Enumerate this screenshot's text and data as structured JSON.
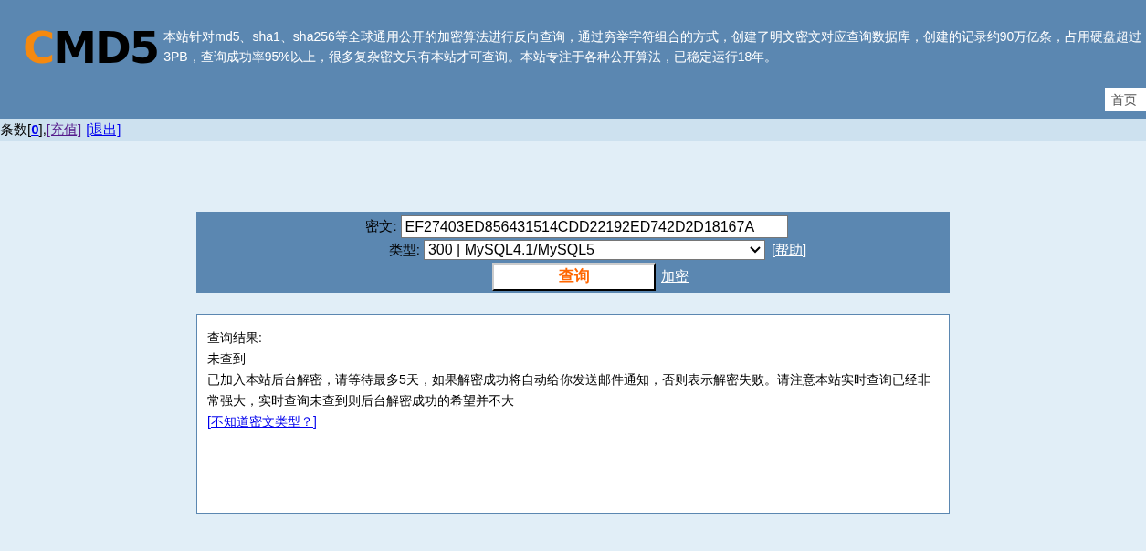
{
  "header": {
    "logo_first": "C",
    "logo_rest": "MD5",
    "intro": "本站针对md5、sha1、sha256等全球通用公开的加密算法进行反向查询，通过穷举字符组合的方式，创建了明文密文对应查询数据库，创建的记录约90万亿条，占用硬盘超过3PB，查询成功率95%以上，很多复杂密文只有本站才可查询。本站专注于各种公开算法，已稳定运行18年。",
    "nav": [
      "首页"
    ]
  },
  "user_bar": {
    "label_open": "条数[",
    "count": "0",
    "label_close": "],",
    "links": [
      {
        "text": "[充值]",
        "visited": true
      },
      {
        "text": "[退出]",
        "visited": false
      }
    ]
  },
  "form": {
    "cipher_label": "密文:",
    "cipher_value": "EF27403ED856431514CDD22192ED742D2D18167A",
    "type_label": "类型:",
    "type_value": "300 | MySQL4.1/MySQL5",
    "help_link": "[帮助]",
    "submit": "查询",
    "encrypt_link": "加密"
  },
  "result": {
    "title": "查询结果:",
    "status": "未查到",
    "message": "已加入本站后台解密，请等待最多5天，如果解密成功将自动给你发送邮件通知，否则表示解密失败。请注意本站实时查询已经非常强大，实时查询未查到则后台解密成功的希望并不大",
    "link": "[不知道密文类型？]"
  }
}
